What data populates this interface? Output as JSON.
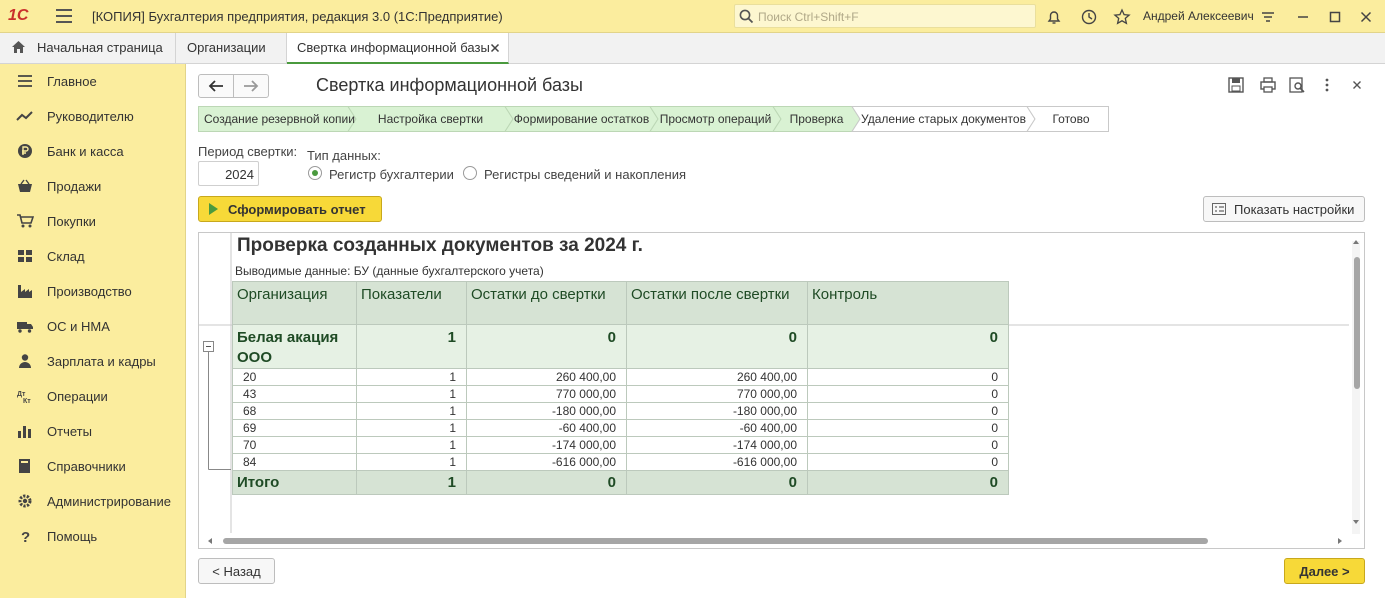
{
  "app": {
    "logo": "1С",
    "title": "[КОПИЯ] Бухгалтерия предприятия, редакция 3.0  (1С:Предприятие)",
    "search_placeholder": "Поиск Ctrl+Shift+F",
    "user": "Андрей Алексеевич"
  },
  "tabs": [
    {
      "label": "Начальная страница",
      "icon": "home-icon"
    },
    {
      "label": "Организации"
    },
    {
      "label": "Свертка информационной базы",
      "active": true
    }
  ],
  "sidebar": {
    "items": [
      {
        "label": "Главное",
        "icon": "menu-icon"
      },
      {
        "label": "Руководителю",
        "icon": "trend-icon"
      },
      {
        "label": "Банк и касса",
        "icon": "ruble-icon"
      },
      {
        "label": "Продажи",
        "icon": "basket-icon"
      },
      {
        "label": "Покупки",
        "icon": "cart-icon"
      },
      {
        "label": "Склад",
        "icon": "warehouse-icon"
      },
      {
        "label": "Производство",
        "icon": "factory-icon"
      },
      {
        "label": "ОС и НМА",
        "icon": "truck-icon"
      },
      {
        "label": "Зарплата и кадры",
        "icon": "person-icon"
      },
      {
        "label": "Операции",
        "icon": "dt-kt-icon"
      },
      {
        "label": "Отчеты",
        "icon": "bar-chart-icon"
      },
      {
        "label": "Справочники",
        "icon": "book-icon"
      },
      {
        "label": "Администрирование",
        "icon": "gear-icon"
      },
      {
        "label": "Помощь",
        "icon": "question-icon"
      }
    ]
  },
  "form": {
    "title": "Свертка информационной базы",
    "steps": [
      {
        "label": "Создание резервной копии",
        "done": true
      },
      {
        "label": "Настройка свертки",
        "done": true
      },
      {
        "label": "Формирование остатков",
        "done": true
      },
      {
        "label": "Просмотр операций",
        "done": true
      },
      {
        "label": "Проверка",
        "done": true
      },
      {
        "label": "Удаление старых документов",
        "done": false
      },
      {
        "label": "Готово",
        "done": false
      }
    ],
    "period_label": "Период свертки:",
    "period_value": "2024",
    "type_label": "Тип данных:",
    "type_options": [
      {
        "label": "Регистр бухгалтерии",
        "selected": true
      },
      {
        "label": "Регистры сведений и накопления",
        "selected": false
      }
    ],
    "generate_button": "Сформировать отчет",
    "settings_button": "Показать настройки",
    "back_button": "< Назад",
    "next_button": "Далее >"
  },
  "report": {
    "title": "Проверка созданных документов за 2024 г.",
    "subtitle": "Выводимые данные: БУ (данные бухгалтерского учета)",
    "columns": [
      "Организация",
      "Показатели",
      "Остатки до свертки",
      "Остатки после свертки",
      "Контроль"
    ],
    "group": {
      "name": "Белая акация ООО",
      "indicators": "1",
      "before": "0",
      "after": "0",
      "control": "0"
    },
    "rows": [
      {
        "account": "20",
        "indicators": "1",
        "before": "260 400,00",
        "after": "260 400,00",
        "control": "0"
      },
      {
        "account": "43",
        "indicators": "1",
        "before": "770 000,00",
        "after": "770 000,00",
        "control": "0"
      },
      {
        "account": "68",
        "indicators": "1",
        "before": "-180 000,00",
        "after": "-180 000,00",
        "control": "0"
      },
      {
        "account": "69",
        "indicators": "1",
        "before": "-60 400,00",
        "after": "-60 400,00",
        "control": "0"
      },
      {
        "account": "70",
        "indicators": "1",
        "before": "-174 000,00",
        "after": "-174 000,00",
        "control": "0"
      },
      {
        "account": "84",
        "indicators": "1",
        "before": "-616 000,00",
        "after": "-616 000,00",
        "control": "0"
      }
    ],
    "total": {
      "label": "Итого",
      "indicators": "1",
      "before": "0",
      "after": "0",
      "control": "0"
    }
  },
  "colors": {
    "titlebar": "#fbed9e",
    "accent_green": "#4a9a3e",
    "step_done": "#d9f2d3",
    "button_yellow": "#f7d938"
  }
}
